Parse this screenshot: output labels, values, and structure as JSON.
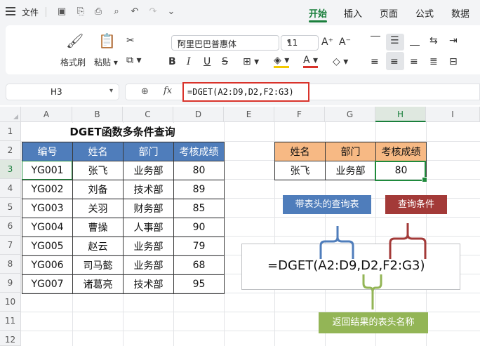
{
  "menu": {
    "file_label": "文件",
    "tabs": [
      "开始",
      "插入",
      "页面",
      "公式",
      "数据"
    ],
    "active_tab": "开始"
  },
  "ribbon": {
    "format_painter": "格式刷",
    "paste": "粘贴",
    "font_name": "阿里巴巴普惠体",
    "font_size": "11"
  },
  "formula_bar": {
    "cell_ref": "H3",
    "fx": "fx",
    "formula": "=DGET(A2:D9,D2,F2:G3)"
  },
  "grid": {
    "columns": [
      "A",
      "B",
      "C",
      "D",
      "E",
      "F",
      "G",
      "H",
      "I"
    ],
    "selected_column": "H",
    "rows": [
      "1",
      "2",
      "3",
      "4",
      "5",
      "6",
      "7",
      "8",
      "9",
      "10",
      "11",
      "12"
    ],
    "selected_row": "3"
  },
  "sheet": {
    "title": "DGET函数多条件查询",
    "table1": {
      "headers": [
        "编号",
        "姓名",
        "部门",
        "考核成绩"
      ],
      "rows": [
        [
          "YG001",
          "张飞",
          "业务部",
          "80"
        ],
        [
          "YG002",
          "刘备",
          "技术部",
          "89"
        ],
        [
          "YG003",
          "关羽",
          "财务部",
          "85"
        ],
        [
          "YG004",
          "曹操",
          "人事部",
          "90"
        ],
        [
          "YG005",
          "赵云",
          "业务部",
          "79"
        ],
        [
          "YG006",
          "司马懿",
          "业务部",
          "68"
        ],
        [
          "YG007",
          "诸葛亮",
          "技术部",
          "95"
        ]
      ]
    },
    "table2": {
      "headers": [
        "姓名",
        "部门",
        "考核成绩"
      ],
      "row": [
        "张飞",
        "业务部",
        "80"
      ]
    }
  },
  "callouts": {
    "header_table_label": "带表头的查询表",
    "criteria_label": "查询条件",
    "result_header_label": "返回结果的表头名称",
    "formula_display": "=DGET(A2:D9,D2,F2:G3)",
    "colors": {
      "blue": "#4f7dbb",
      "red": "#a33a38",
      "green": "#93b556"
    }
  }
}
